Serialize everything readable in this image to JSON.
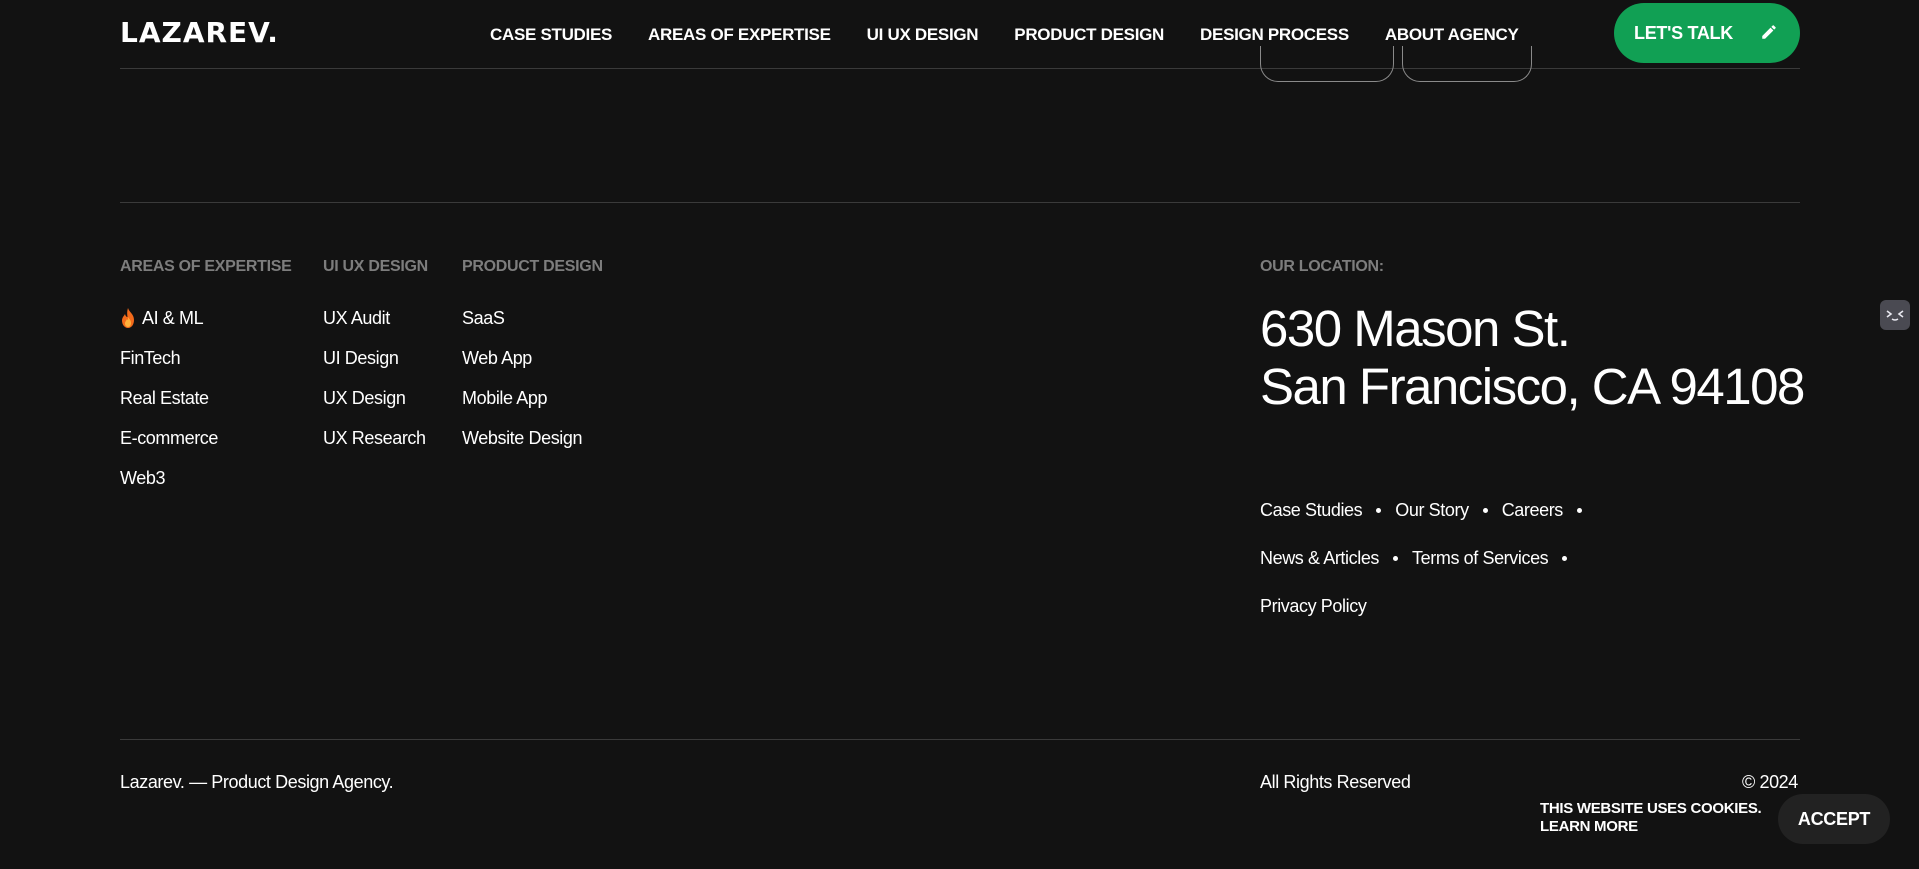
{
  "header": {
    "logo": "LAZAREV.",
    "nav": [
      "CASE STUDIES",
      "AREAS OF EXPERTISE",
      "UI UX DESIGN",
      "PRODUCT DESIGN",
      "DESIGN PROCESS",
      "ABOUT AGENCY"
    ],
    "cta": "LET'S TALK"
  },
  "footer": {
    "columns": [
      {
        "title": "AREAS OF EXPERTISE",
        "items": [
          "AI & ML",
          "FinTech",
          "Real Estate",
          "E-commerce",
          "Web3"
        ]
      },
      {
        "title": "UI UX DESIGN",
        "items": [
          "UX Audit",
          "UI Design",
          "UX Design",
          "UX Research"
        ]
      },
      {
        "title": "PRODUCT DESIGN",
        "items": [
          "SaaS",
          "Web App",
          "Mobile App",
          "Website Design"
        ]
      }
    ],
    "location": {
      "label": "OUR LOCATION:",
      "line1": "630 Mason St.",
      "line2": "San Francisco, CA 94108"
    },
    "links": {
      "row1": [
        "Case Studies",
        "Our Story",
        "Careers"
      ],
      "row2": [
        "News & Articles",
        "Terms of Services"
      ],
      "row3": [
        "Privacy Policy"
      ]
    },
    "tagline": "Lazarev. — Product Design Agency.",
    "rights": "All Rights Reserved",
    "copyright": "© 2024"
  },
  "cookie": {
    "message": "THIS WEBSITE USES COOKIES.",
    "learn_more": "LEARN MORE",
    "accept": "ACCEPT"
  },
  "icons": {
    "ai_item": "flame-icon",
    "cta": "pencil-icon",
    "side": "chat-widget-icon"
  },
  "colors": {
    "background": "#121212",
    "accent": "#11a054",
    "muted": "#7d7d7d"
  }
}
